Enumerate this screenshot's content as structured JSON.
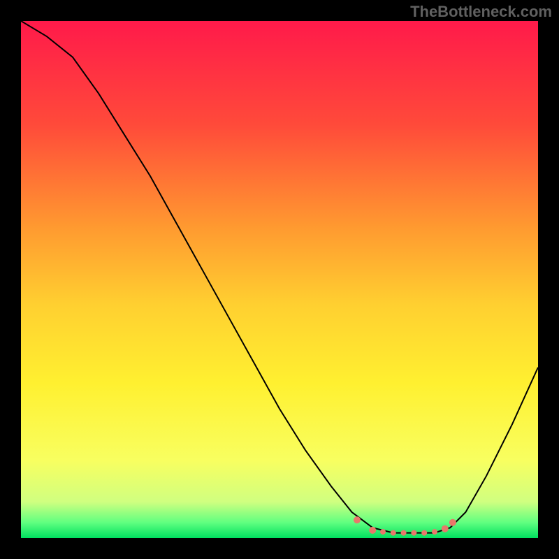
{
  "watermark": "TheBottleneck.com",
  "chart_data": {
    "type": "line",
    "title": "",
    "xlabel": "",
    "ylabel": "",
    "xlim": [
      0,
      100
    ],
    "ylim": [
      0,
      100
    ],
    "background_gradient": {
      "stops": [
        {
          "offset": 0,
          "color": "#ff1a4a"
        },
        {
          "offset": 20,
          "color": "#ff4a3a"
        },
        {
          "offset": 40,
          "color": "#ff9a30"
        },
        {
          "offset": 55,
          "color": "#ffd030"
        },
        {
          "offset": 70,
          "color": "#fff030"
        },
        {
          "offset": 85,
          "color": "#f8ff60"
        },
        {
          "offset": 93,
          "color": "#d0ff80"
        },
        {
          "offset": 97,
          "color": "#60ff80"
        },
        {
          "offset": 100,
          "color": "#00e060"
        }
      ]
    },
    "series": [
      {
        "name": "curve",
        "color": "#000000",
        "width": 2,
        "points": [
          {
            "x": 0,
            "y": 100
          },
          {
            "x": 5,
            "y": 97
          },
          {
            "x": 10,
            "y": 93
          },
          {
            "x": 15,
            "y": 86
          },
          {
            "x": 20,
            "y": 78
          },
          {
            "x": 25,
            "y": 70
          },
          {
            "x": 30,
            "y": 61
          },
          {
            "x": 35,
            "y": 52
          },
          {
            "x": 40,
            "y": 43
          },
          {
            "x": 45,
            "y": 34
          },
          {
            "x": 50,
            "y": 25
          },
          {
            "x": 55,
            "y": 17
          },
          {
            "x": 60,
            "y": 10
          },
          {
            "x": 64,
            "y": 5
          },
          {
            "x": 68,
            "y": 2
          },
          {
            "x": 72,
            "y": 1
          },
          {
            "x": 76,
            "y": 1
          },
          {
            "x": 80,
            "y": 1
          },
          {
            "x": 83,
            "y": 2
          },
          {
            "x": 86,
            "y": 5
          },
          {
            "x": 90,
            "y": 12
          },
          {
            "x": 95,
            "y": 22
          },
          {
            "x": 100,
            "y": 33
          }
        ]
      }
    ],
    "markers": [
      {
        "x": 65,
        "y": 3.5,
        "r": 5,
        "color": "#e8786a"
      },
      {
        "x": 68,
        "y": 1.5,
        "r": 5,
        "color": "#e8786a"
      },
      {
        "x": 70,
        "y": 1.2,
        "r": 4,
        "color": "#e8786a"
      },
      {
        "x": 72,
        "y": 1.0,
        "r": 4,
        "color": "#e8786a"
      },
      {
        "x": 74,
        "y": 1.0,
        "r": 4,
        "color": "#e8786a"
      },
      {
        "x": 76,
        "y": 1.0,
        "r": 4,
        "color": "#e8786a"
      },
      {
        "x": 78,
        "y": 1.0,
        "r": 4,
        "color": "#e8786a"
      },
      {
        "x": 80,
        "y": 1.2,
        "r": 4,
        "color": "#e8786a"
      },
      {
        "x": 82,
        "y": 1.8,
        "r": 5,
        "color": "#e8786a"
      },
      {
        "x": 83.5,
        "y": 3.0,
        "r": 5,
        "color": "#e8786a"
      }
    ]
  }
}
